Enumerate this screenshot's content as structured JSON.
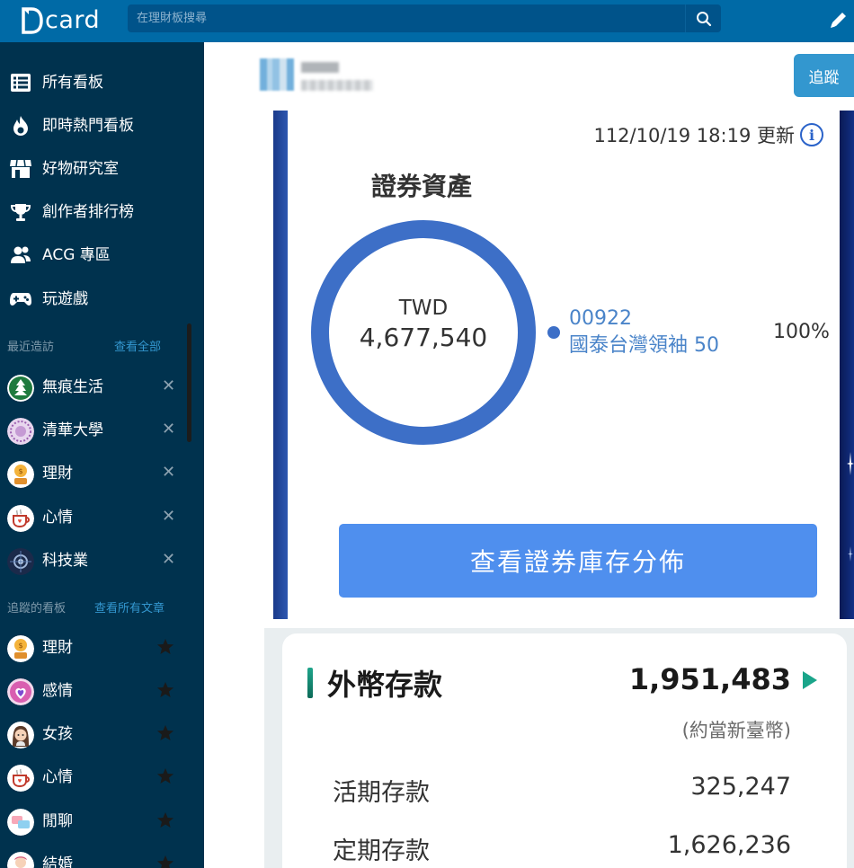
{
  "topbar": {
    "logo_text": "card",
    "search_placeholder": "在理財板搜尋"
  },
  "sidebar": {
    "nav": [
      {
        "label": "所有看板",
        "icon": "list-icon"
      },
      {
        "label": "即時熱門看板",
        "icon": "flame-icon"
      },
      {
        "label": "好物研究室",
        "icon": "store-icon"
      },
      {
        "label": "創作者排行榜",
        "icon": "trophy-icon"
      },
      {
        "label": "ACG 專區",
        "icon": "users-icon"
      },
      {
        "label": "玩遊戲",
        "icon": "gamepad-icon"
      }
    ],
    "recent": {
      "title": "最近造訪",
      "link": "查看全部",
      "items": [
        {
          "label": "無痕生活",
          "close": "✕"
        },
        {
          "label": "清華大學",
          "close": "✕"
        },
        {
          "label": "理財",
          "close": "✕"
        },
        {
          "label": "心情",
          "close": "✕"
        },
        {
          "label": "科技業",
          "close": "✕"
        }
      ]
    },
    "following": {
      "title": "追蹤的看板",
      "link": "查看所有文章",
      "items": [
        {
          "label": "理財"
        },
        {
          "label": "感情"
        },
        {
          "label": "女孩"
        },
        {
          "label": "心情"
        },
        {
          "label": "閒聊"
        },
        {
          "label": "結婚"
        }
      ]
    }
  },
  "post": {
    "follow_label": "追蹤"
  },
  "securities": {
    "updated": "112/10/19 18:19 更新",
    "info_glyph": "i",
    "title": "證券資產",
    "currency": "TWD",
    "total": "4,677,540",
    "holding_code": "00922",
    "holding_name": "國泰台灣領袖 50",
    "holding_pct": "100%",
    "holding_share": 1.0,
    "button_label": "查看證券庫存分佈"
  },
  "fx_deposit": {
    "title": "外幣存款",
    "total": "1,951,483",
    "note": "(約當新臺幣)",
    "rows": [
      {
        "label": "活期存款",
        "value": "325,247"
      },
      {
        "label": "定期存款",
        "value": "1,626,236"
      }
    ]
  },
  "colors": {
    "topbar": "#006aa6",
    "sidebar": "#00324e",
    "accent": "#3397cf",
    "donut": "#3d6fc7",
    "button": "#4f8fee",
    "fx_accent": "#1aa58a"
  }
}
